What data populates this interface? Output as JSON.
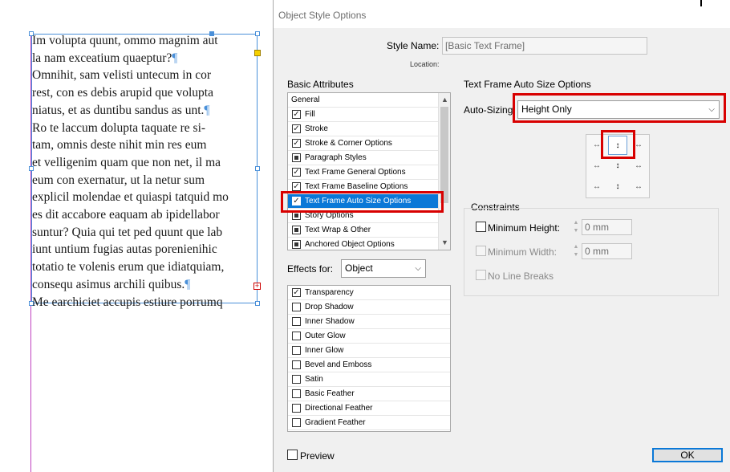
{
  "document": {
    "lines": [
      "Im volupta quunt, ommo magnim aut",
      "la nam exceatium quaeptur?",
      "Omnihit, sam velisti untecum in cor",
      "rest, con es debis arupid que volupta",
      "niatus, et as duntibu sandus as unt.",
      "Ro te laccum dolupta taquate re si-",
      "tam, omnis deste nihit min res eum",
      "et velligenim quam que non net, il ma",
      "eum con exernatur, ut la netur sum",
      "explicil molendae et quiaspi tatquid mo",
      "es dit accabore eaquam ab ipidellabor",
      "suntur? Quia qui tet ped quunt que lab",
      "iunt untium fugias autas porenienihic",
      "totatio te volenis erum que idiatquiam,",
      "consequ asimus archili quibus.",
      "Me earchiciet accupis estiure porrumq"
    ],
    "pilcrow": "¶",
    "overset_glyph": "+"
  },
  "dialog": {
    "title": "Object Style Options",
    "style_name_label": "Style Name:",
    "style_name_value": "[Basic Text Frame]",
    "location_label": "Location:",
    "basic_attributes_label": "Basic Attributes",
    "basic_attributes": [
      {
        "label": "General",
        "check": "none",
        "header": true
      },
      {
        "label": "Fill",
        "check": "checked"
      },
      {
        "label": "Stroke",
        "check": "checked"
      },
      {
        "label": "Stroke & Corner Options",
        "check": "checked"
      },
      {
        "label": "Paragraph Styles",
        "check": "solid"
      },
      {
        "label": "Text Frame General Options",
        "check": "checked"
      },
      {
        "label": "Text Frame Baseline Options",
        "check": "checked"
      },
      {
        "label": "Text Frame Auto Size Options",
        "check": "checked",
        "selected": true
      },
      {
        "label": "Story Options",
        "check": "solid"
      },
      {
        "label": "Text Wrap & Other",
        "check": "solid"
      },
      {
        "label": "Anchored Object Options",
        "check": "solid"
      }
    ],
    "effects_for_label": "Effects for:",
    "effects_for_value": "Object",
    "effects": [
      {
        "label": "Transparency",
        "check": "checked"
      },
      {
        "label": "Drop Shadow",
        "check": "empty"
      },
      {
        "label": "Inner Shadow",
        "check": "empty"
      },
      {
        "label": "Outer Glow",
        "check": "empty"
      },
      {
        "label": "Inner Glow",
        "check": "empty"
      },
      {
        "label": "Bevel and Emboss",
        "check": "empty"
      },
      {
        "label": "Satin",
        "check": "empty"
      },
      {
        "label": "Basic Feather",
        "check": "empty"
      },
      {
        "label": "Directional Feather",
        "check": "empty"
      },
      {
        "label": "Gradient Feather",
        "check": "empty"
      }
    ],
    "section_title": "Text Frame Auto Size Options",
    "auto_sizing_label": "Auto-Sizing:",
    "auto_sizing_value": "Height Only",
    "reference_glyphs": [
      "↔",
      "↕",
      "↔",
      "↔",
      "↕",
      "↔",
      "↔",
      "↕",
      "↔"
    ],
    "constraints_label": "Constraints",
    "min_height_label": "Minimum Height:",
    "min_height_value": "0 mm",
    "min_width_label": "Minimum Width:",
    "min_width_value": "0 mm",
    "no_line_breaks_label": "No Line Breaks",
    "preview_label": "Preview",
    "ok_label": "OK"
  },
  "colors": {
    "selection_blue": "#0a78d7",
    "highlight_red": "#d80000",
    "frame_blue": "#4a90d9"
  }
}
